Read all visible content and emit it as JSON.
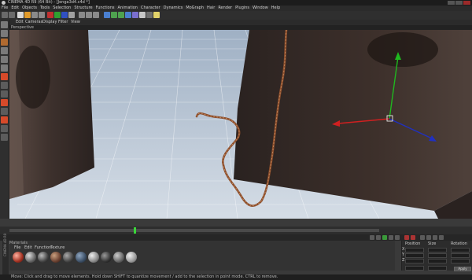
{
  "app": {
    "title": "CINEMA 4D R9 (64 Bit) - [Jenga3d4.c4d *]"
  },
  "menu": [
    "File",
    "Edit",
    "Objects",
    "Tools",
    "Selection",
    "Structure",
    "Functions",
    "Animation",
    "Character",
    "Dynamics",
    "MoGraph",
    "Hair",
    "Render",
    "Plugins",
    "Window",
    "Help"
  ],
  "viewport_menu": [
    "Edit",
    "Cameras",
    "Display",
    "Filter",
    "View"
  ],
  "viewport_label": "Perspective",
  "materials": {
    "title": "Materials",
    "menu": [
      "File",
      "Edit",
      "Function",
      "Texture"
    ]
  },
  "coordinates": {
    "headers": [
      "Position",
      "Size",
      "Rotation"
    ],
    "axes": [
      "X",
      "Y",
      "Z"
    ],
    "apply_label": "Apply"
  },
  "status": {
    "text": "Move: Click and drag to move elements. Hold down SHIFT to quantize movement / add to the selection in point mode. CTRL to remove."
  },
  "side_label": "CINEMA 4D R9",
  "colors": {
    "sky": "#6f88a6",
    "floor": "#c6d0dc",
    "box": "#2e2422",
    "chain": "#8a4a2c",
    "axis_x": "#d02020",
    "axis_y": "#1fb81f",
    "axis_z": "#2030c0"
  },
  "icons": {
    "toolbar": [
      "undo-icon",
      "redo-icon",
      "select-icon",
      "move-icon",
      "scale-icon",
      "rotate-icon",
      "x-axis-icon",
      "y-axis-icon",
      "z-axis-icon",
      "coord-icon",
      "render-view-icon",
      "render-icon",
      "render-settings-icon",
      "cube-icon",
      "pen-icon",
      "subdivision-icon",
      "array-icon",
      "deformer-icon",
      "scene-icon",
      "camera-icon",
      "light-icon"
    ],
    "left": [
      "model-icon",
      "object-icon",
      "texture-icon",
      "points-icon",
      "edges-icon",
      "polygons-icon",
      "axis-icon",
      "snap-icon",
      "workplane-icon",
      "tweak-icon",
      "solo-icon",
      "layout-icon",
      "grid-icon",
      "render-region-icon"
    ]
  }
}
